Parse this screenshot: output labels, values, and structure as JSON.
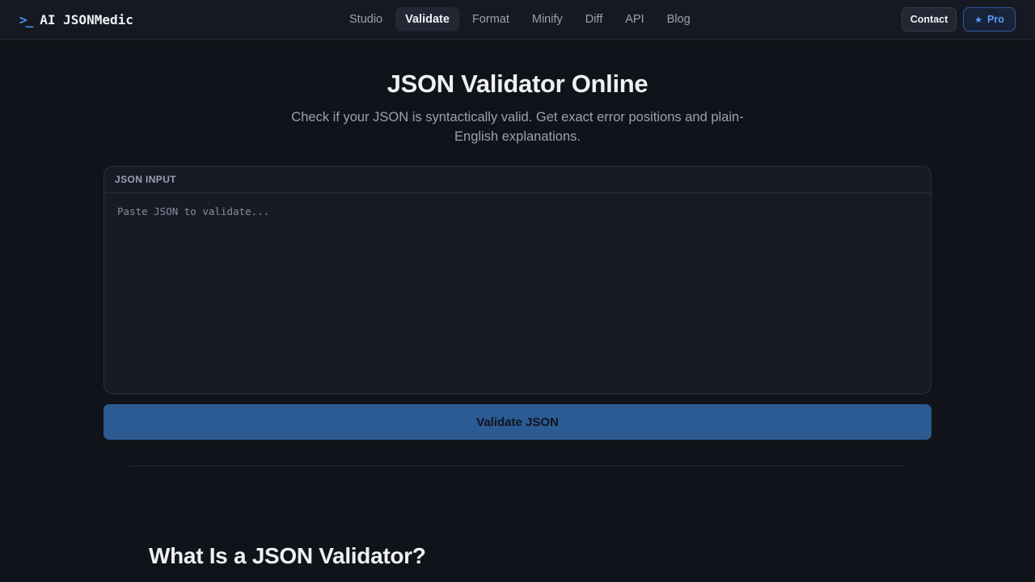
{
  "header": {
    "brand_icon": ">_",
    "brand_name": "AI JSONMedic",
    "nav": [
      {
        "label": "Studio"
      },
      {
        "label": "Validate",
        "active": true
      },
      {
        "label": "Format"
      },
      {
        "label": "Minify"
      },
      {
        "label": "Diff"
      },
      {
        "label": "API"
      },
      {
        "label": "Blog"
      }
    ],
    "contact_label": "Contact",
    "pro_label": "Pro",
    "pro_icon": "star-icon"
  },
  "hero": {
    "title": "JSON Validator Online",
    "subtitle": "Check if your JSON is syntactically valid. Get exact error positions and plain-English explanations."
  },
  "input_panel": {
    "header": "JSON INPUT",
    "placeholder": "Paste JSON to validate...",
    "value": ""
  },
  "validate_button_label": "Validate JSON",
  "section": {
    "title": "What Is a JSON Validator?"
  },
  "colors": {
    "background": "#11131a",
    "accent": "#4f8ff7",
    "button": "#2c5a92"
  }
}
